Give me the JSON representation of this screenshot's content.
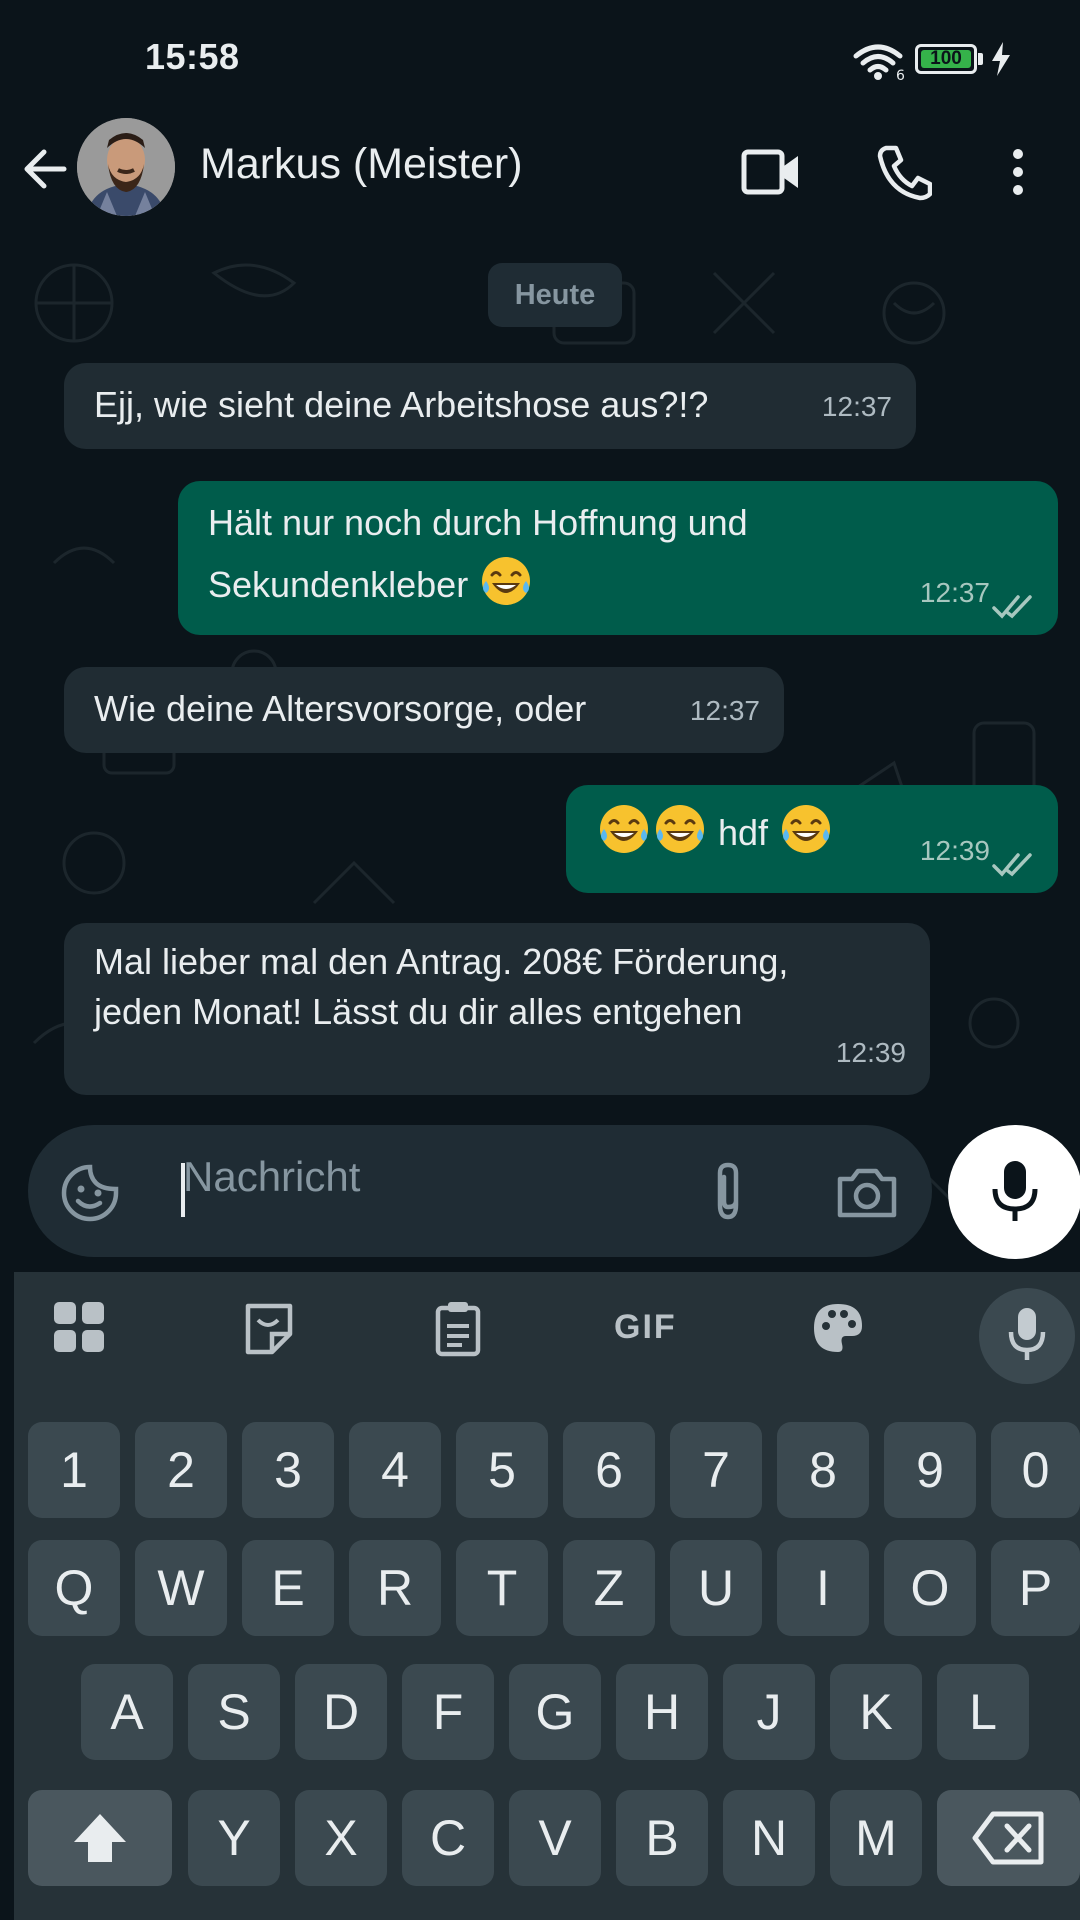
{
  "status_bar": {
    "time": "15:58",
    "battery": "100",
    "wifi_label": "6"
  },
  "header": {
    "contact_name": "Markus (Meister)"
  },
  "chat": {
    "date_chip": "Heute",
    "messages": [
      {
        "dir": "in",
        "text": "Ejj, wie sieht deine Arbeitshose aus?!?",
        "time": "12:37"
      },
      {
        "dir": "out",
        "line1": "Hält nur noch durch Hoffnung und",
        "line2": "Sekundenkleber",
        "time": "12:37"
      },
      {
        "dir": "in",
        "text": "Wie deine Altersvorsorge, oder",
        "time": "12:37"
      },
      {
        "dir": "out",
        "text": "hdf",
        "time": "12:39"
      },
      {
        "dir": "in",
        "line1": "Mal lieber mal den Antrag. 208€ Förderung,",
        "line2": "jeden Monat!  Lässt du dir alles entgehen",
        "time": "12:39"
      }
    ]
  },
  "composer": {
    "placeholder": "Nachricht"
  },
  "keyboard": {
    "toolbar": {
      "gif": "GIF"
    },
    "row_numbers": [
      "1",
      "2",
      "3",
      "4",
      "5",
      "6",
      "7",
      "8",
      "9",
      "0"
    ],
    "row_top": [
      "Q",
      "W",
      "E",
      "R",
      "T",
      "Z",
      "U",
      "I",
      "O",
      "P"
    ],
    "row_mid": [
      "A",
      "S",
      "D",
      "F",
      "G",
      "H",
      "J",
      "K",
      "L"
    ],
    "row_bottom": [
      "Y",
      "X",
      "C",
      "V",
      "B",
      "N",
      "M"
    ]
  }
}
